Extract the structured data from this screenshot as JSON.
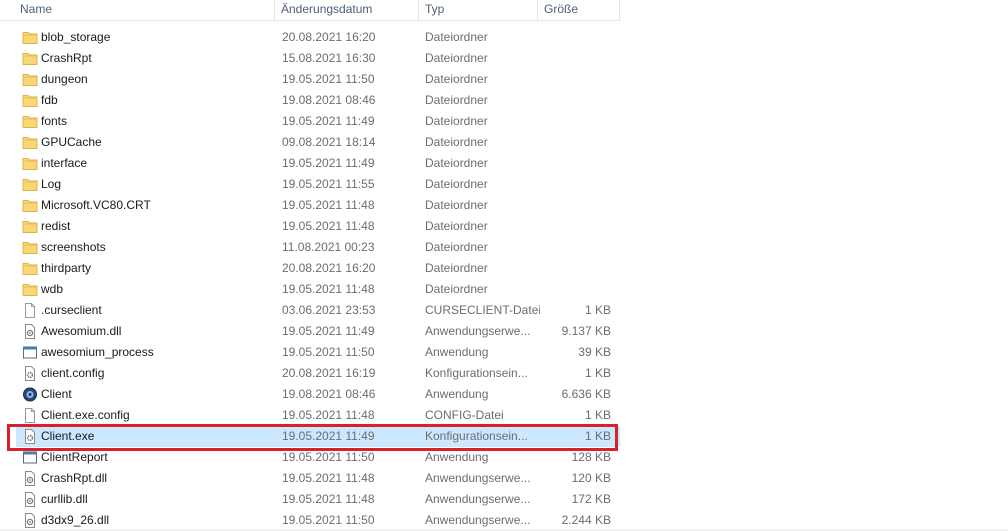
{
  "columns": {
    "name": "Name",
    "date": "Änderungsdatum",
    "type": "Typ",
    "size": "Größe"
  },
  "colors": {
    "selection": "#cce8ff",
    "highlight": "#d9202d",
    "folder": "#f8d775"
  },
  "files": [
    {
      "name": "blob_storage",
      "date": "20.08.2021 16:20",
      "type": "Dateiordner",
      "size": "",
      "icon": "folder-icon"
    },
    {
      "name": "CrashRpt",
      "date": "15.08.2021 16:30",
      "type": "Dateiordner",
      "size": "",
      "icon": "folder-icon"
    },
    {
      "name": "dungeon",
      "date": "19.05.2021 11:50",
      "type": "Dateiordner",
      "size": "",
      "icon": "folder-icon"
    },
    {
      "name": "fdb",
      "date": "19.08.2021 08:46",
      "type": "Dateiordner",
      "size": "",
      "icon": "folder-icon"
    },
    {
      "name": "fonts",
      "date": "19.05.2021 11:49",
      "type": "Dateiordner",
      "size": "",
      "icon": "folder-icon"
    },
    {
      "name": "GPUCache",
      "date": "09.08.2021 18:14",
      "type": "Dateiordner",
      "size": "",
      "icon": "folder-icon"
    },
    {
      "name": "interface",
      "date": "19.05.2021 11:49",
      "type": "Dateiordner",
      "size": "",
      "icon": "folder-icon"
    },
    {
      "name": "Log",
      "date": "19.05.2021 11:55",
      "type": "Dateiordner",
      "size": "",
      "icon": "folder-icon"
    },
    {
      "name": "Microsoft.VC80.CRT",
      "date": "19.05.2021 11:48",
      "type": "Dateiordner",
      "size": "",
      "icon": "folder-icon"
    },
    {
      "name": "redist",
      "date": "19.05.2021 11:48",
      "type": "Dateiordner",
      "size": "",
      "icon": "folder-icon"
    },
    {
      "name": "screenshots",
      "date": "11.08.2021 00:23",
      "type": "Dateiordner",
      "size": "",
      "icon": "folder-icon"
    },
    {
      "name": "thirdparty",
      "date": "20.08.2021 16:20",
      "type": "Dateiordner",
      "size": "",
      "icon": "folder-icon"
    },
    {
      "name": "wdb",
      "date": "19.05.2021 11:48",
      "type": "Dateiordner",
      "size": "",
      "icon": "folder-icon"
    },
    {
      "name": ".curseclient",
      "date": "03.06.2021 23:53",
      "type": "CURSECLIENT-Datei",
      "size": "1 KB",
      "icon": "blank-file-icon"
    },
    {
      "name": "Awesomium.dll",
      "date": "19.05.2021 11:49",
      "type": "Anwendungserwe...",
      "size": "9.137 KB",
      "icon": "dll-file-icon"
    },
    {
      "name": "awesomium_process",
      "date": "19.05.2021 11:50",
      "type": "Anwendung",
      "size": "39 KB",
      "icon": "app-window-icon"
    },
    {
      "name": "client.config",
      "date": "20.08.2021 16:19",
      "type": "Konfigurationsein...",
      "size": "1 KB",
      "icon": "config-file-icon"
    },
    {
      "name": "Client",
      "date": "19.08.2021 08:46",
      "type": "Anwendung",
      "size": "6.636 KB",
      "icon": "client-app-icon"
    },
    {
      "name": "Client.exe.config",
      "date": "19.05.2021 11:48",
      "type": "CONFIG-Datei",
      "size": "1 KB",
      "icon": "blank-file-icon"
    },
    {
      "name": "Client.exe",
      "date": "19.05.2021 11:49",
      "type": "Konfigurationsein...",
      "size": "1 KB",
      "icon": "config-file-icon",
      "selected": true
    },
    {
      "name": "ClientReport",
      "date": "19.05.2021 11:50",
      "type": "Anwendung",
      "size": "128 KB",
      "icon": "app-window-icon"
    },
    {
      "name": "CrashRpt.dll",
      "date": "19.05.2021 11:48",
      "type": "Anwendungserwe...",
      "size": "120 KB",
      "icon": "dll-file-icon"
    },
    {
      "name": "curllib.dll",
      "date": "19.05.2021 11:48",
      "type": "Anwendungserwe...",
      "size": "172 KB",
      "icon": "dll-file-icon"
    },
    {
      "name": "d3dx9_26.dll",
      "date": "19.05.2021 11:50",
      "type": "Anwendungserwe...",
      "size": "2.244 KB",
      "icon": "dll-file-icon"
    }
  ]
}
